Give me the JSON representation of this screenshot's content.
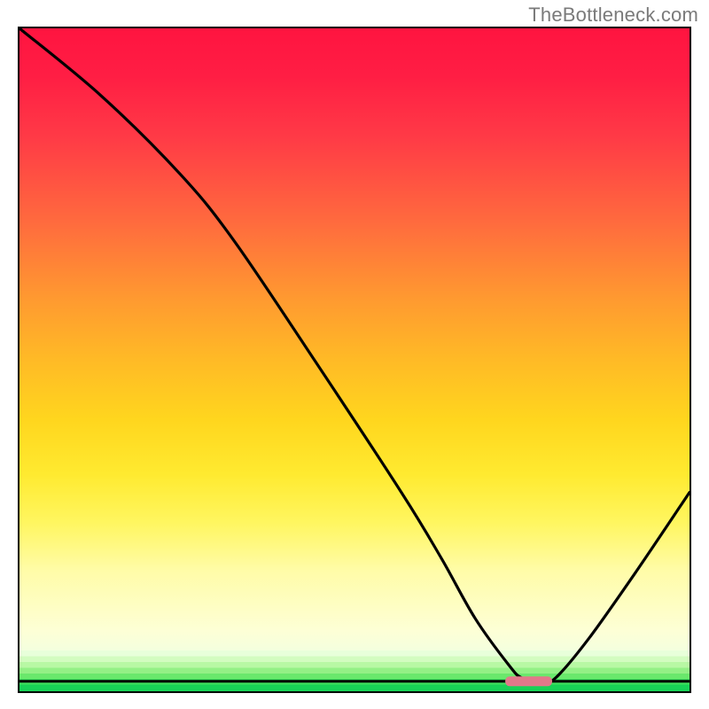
{
  "watermark_text": "TheBottleneck.com",
  "colors": {
    "gradient_top": "#ff1440",
    "gradient_mid": "#ffd61e",
    "gradient_low": "#fdffd6",
    "green_darkest": "#18d256",
    "curve_stroke": "#000000",
    "baseline_stroke": "#000000",
    "marker_fill": "#e2788a",
    "frame_stroke": "#000000"
  },
  "chart_data": {
    "type": "line",
    "title": "",
    "xlabel": "",
    "ylabel": "",
    "xlim": [
      0,
      100
    ],
    "ylim": [
      0,
      100
    ],
    "grid": false,
    "comment": "Background is a continuous heat gradient (red→orange→yellow→pale) occupying ~0–93% of plot height, then stepped green bands to the floor. A black V-shaped curve descends from top-left to a minimum near the marker, then rises to the right edge. Values are read off in 0–100 normalized plot coordinates (x: left→right, y: bottom→top).",
    "series": [
      {
        "name": "curve",
        "x": [
          0,
          12,
          24,
          32,
          44,
          57,
          63,
          68,
          73,
          75,
          78,
          80,
          85,
          92,
          100
        ],
        "y": [
          100,
          90,
          78,
          68,
          50,
          30,
          20,
          11,
          4,
          2,
          1.5,
          2,
          8,
          18,
          30
        ]
      }
    ],
    "baseline": {
      "y": 1.5
    },
    "marker": {
      "x_center": 76,
      "y": 1.5,
      "half_width_x": 3.5
    },
    "annotations": []
  }
}
